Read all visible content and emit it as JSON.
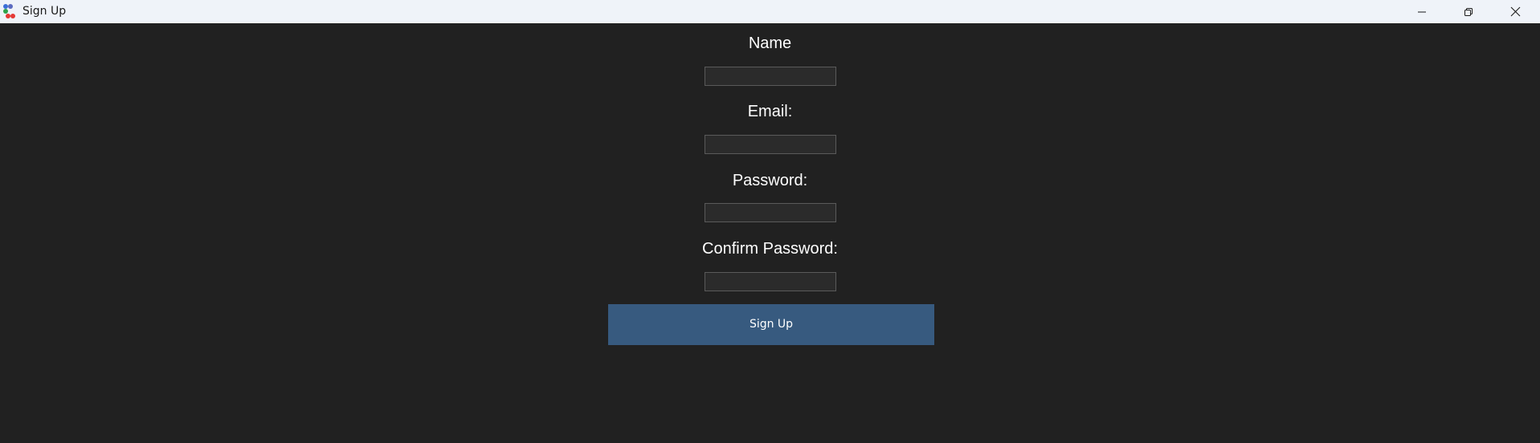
{
  "window": {
    "title": "Sign Up",
    "controls": {
      "minimize_icon": "minimize-icon",
      "maximize_icon": "restore-icon",
      "close_icon": "close-icon"
    },
    "app_icon_colors": [
      "#3b6fd8",
      "#5c6bc0",
      "#2fa24a",
      "#e53935",
      "#e53935"
    ]
  },
  "form": {
    "name_label": "Name",
    "name_value": "",
    "email_label": "Email:",
    "email_value": "",
    "password_label": "Password:",
    "password_value": "",
    "confirm_label": "Confirm Password:",
    "confirm_value": "",
    "submit_label": "Sign Up"
  },
  "colors": {
    "background": "#212121",
    "titlebar": "#eff3f9",
    "button": "#375a7f",
    "input_bg": "#2b2b2b",
    "input_border": "#5a5a5a",
    "text": "#ffffff"
  }
}
